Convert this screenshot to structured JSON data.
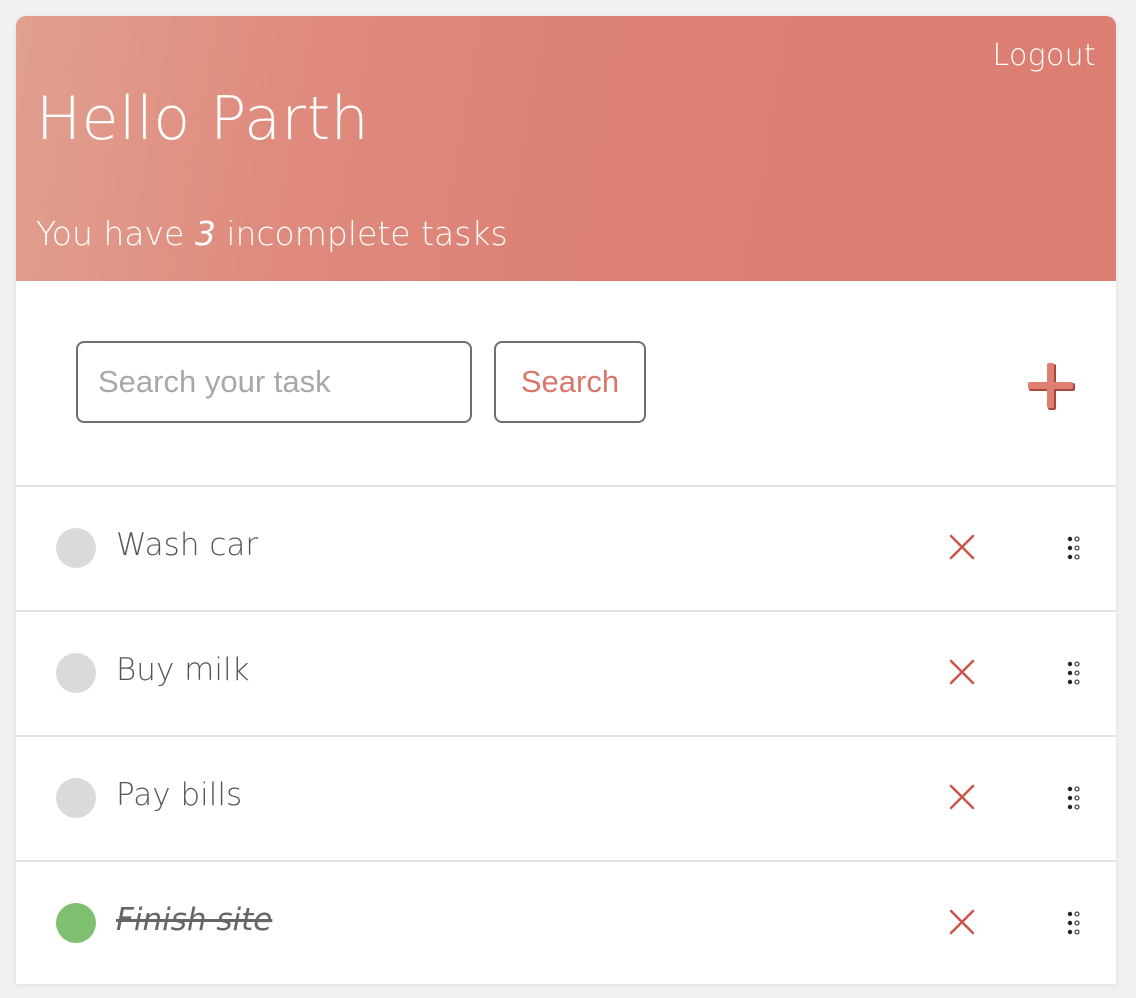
{
  "header": {
    "logout_label": "Logout",
    "greeting": "Hello Parth",
    "subtitle_prefix": "You have ",
    "incomplete_count": "3",
    "subtitle_suffix": " incomplete tasks"
  },
  "search": {
    "placeholder": "Search your task",
    "value": "",
    "button_label": "Search"
  },
  "add_button": {
    "icon": "plus-icon",
    "label": "+"
  },
  "tasks": [
    {
      "label": "Wash car",
      "completed": false
    },
    {
      "label": "Buy milk",
      "completed": false
    },
    {
      "label": "Pay bills",
      "completed": false
    },
    {
      "label": "Finish site",
      "completed": true
    }
  ],
  "icons": {
    "delete": "close-icon",
    "drag": "drag-handle-icon",
    "checkbox": "circle-checkbox"
  },
  "colors": {
    "header_gradient_start": "#e1a090",
    "header_gradient_end": "#dc7e72",
    "accent": "#d9776a",
    "delete_icon": "#c9574d",
    "incomplete_check": "#dadada",
    "complete_check": "#7fbf70",
    "text": "#555555"
  }
}
